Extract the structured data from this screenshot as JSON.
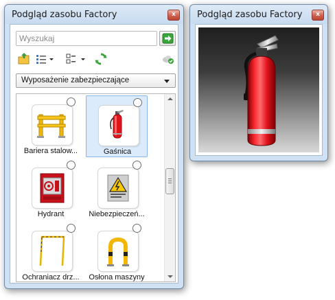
{
  "library_window": {
    "title": "Podgląd zasobu Factory",
    "close_label": "x",
    "search": {
      "placeholder": "Wyszukaj",
      "value": ""
    },
    "toolbar": {
      "icons": [
        "load-library-icon",
        "list-view-icon",
        "view-options-icon",
        "refresh-icon",
        "cloud-sync-icon"
      ]
    },
    "category": {
      "selected": "Wyposażenie zabezpieczające"
    },
    "items": [
      {
        "label": "Bariera stalow...",
        "icon": "barrier-icon",
        "selected": false
      },
      {
        "label": "Gaśnica",
        "icon": "fire-extinguisher-icon",
        "selected": true
      },
      {
        "label": "Hydrant",
        "icon": "hydrant-icon",
        "selected": false
      },
      {
        "label": "Niebezpieczeń...",
        "icon": "warning-sign-icon",
        "selected": false
      },
      {
        "label": "Ochraniacz drz...",
        "icon": "door-guard-icon",
        "selected": false
      },
      {
        "label": "Osłona maszyny",
        "icon": "machine-guard-icon",
        "selected": false
      }
    ]
  },
  "preview_window": {
    "title": "Podgląd zasobu Factory",
    "close_label": "x",
    "preview_subject": "fire-extinguisher-icon"
  },
  "colors": {
    "window_frame": "#cfe1f3",
    "selection_bg": "#dcebfc",
    "extinguisher_red": "#e2141b",
    "barrier_yellow": "#f2b705"
  }
}
